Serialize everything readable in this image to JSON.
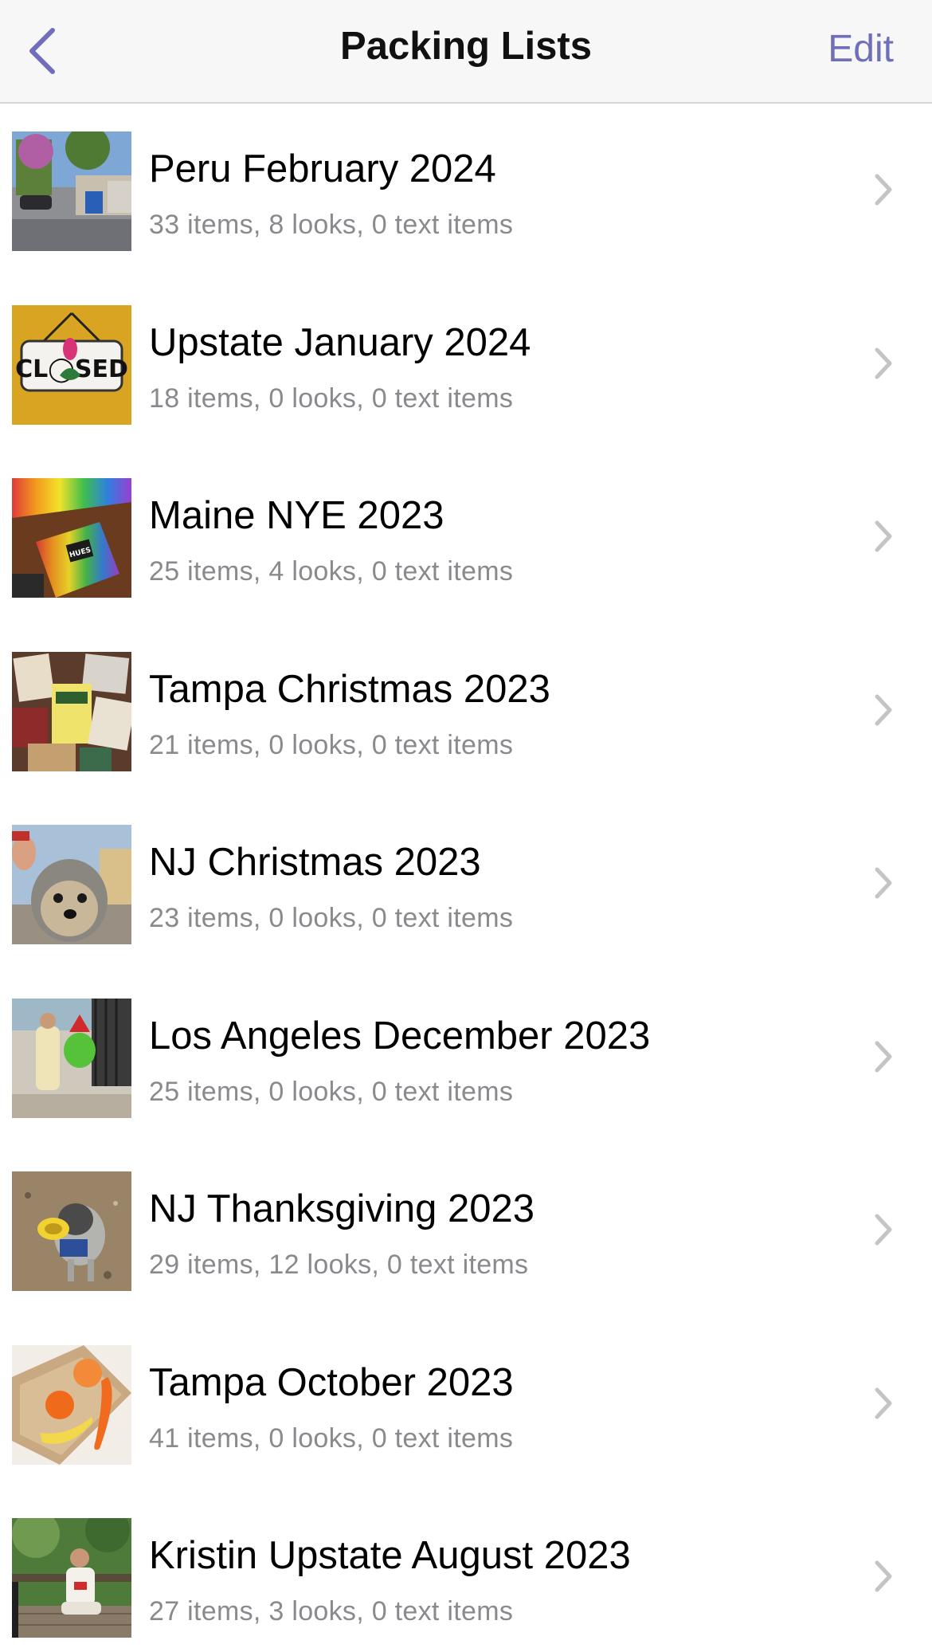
{
  "header": {
    "title": "Packing Lists",
    "edit_label": "Edit",
    "accent_color": "#6e6fb8"
  },
  "lists": [
    {
      "title": "Peru February 2024",
      "subtitle": "33 items, 8 looks, 0 text items",
      "thumb": "street-scene-photo"
    },
    {
      "title": "Upstate January 2024",
      "subtitle": "18 items, 0 looks, 0 text items",
      "thumb": "closed-sign-photo"
    },
    {
      "title": "Maine NYE 2023",
      "subtitle": "25 items, 4 looks, 0 text items",
      "thumb": "color-puzzle-game-photo"
    },
    {
      "title": "Tampa Christmas 2023",
      "subtitle": "21 items, 0 looks, 0 text items",
      "thumb": "matchbooks-photo"
    },
    {
      "title": "NJ Christmas 2023",
      "subtitle": "23 items, 0 looks, 0 text items",
      "thumb": "dog-selfie-photo"
    },
    {
      "title": "Los Angeles December 2023",
      "subtitle": "25 items, 0 looks, 0 text items",
      "thumb": "sidewalk-person-photo"
    },
    {
      "title": "NJ Thanksgiving 2023",
      "subtitle": "29 items, 12 looks, 0 text items",
      "thumb": "dog-with-toy-photo"
    },
    {
      "title": "Tampa October 2023",
      "subtitle": "41 items, 0 looks, 0 text items",
      "thumb": "fruit-box-photo"
    },
    {
      "title": "Kristin Upstate August 2023",
      "subtitle": "27 items, 3 looks, 0 text items",
      "thumb": "person-on-deck-photo"
    }
  ]
}
